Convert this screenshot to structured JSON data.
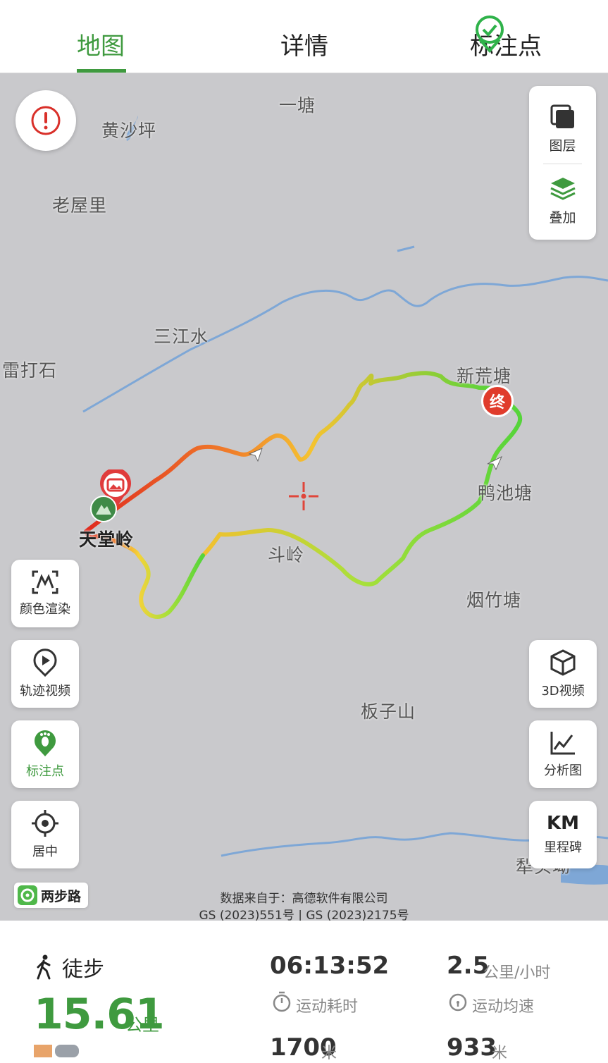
{
  "tabs": [
    {
      "label": "地图",
      "active": true
    },
    {
      "label": "详情",
      "active": false
    },
    {
      "label": "标注点",
      "active": false
    }
  ],
  "map": {
    "places": [
      {
        "name": "一塘",
        "bold": false
      },
      {
        "name": "黄沙坪",
        "bold": false
      },
      {
        "name": "老屋里",
        "bold": false
      },
      {
        "name": "三江水",
        "bold": false
      },
      {
        "name": "雷打石",
        "bold": false
      },
      {
        "name": "新荒塘",
        "bold": false
      },
      {
        "name": "鸭池塘",
        "bold": false
      },
      {
        "name": "天堂岭",
        "bold": true
      },
      {
        "name": "斗岭",
        "bold": false
      },
      {
        "name": "烟竹塘",
        "bold": false
      },
      {
        "name": "板子山",
        "bold": false
      },
      {
        "name": "犁头坳",
        "bold": false
      }
    ],
    "end_marker": "终",
    "layer_label": "图层",
    "overlay_label": "叠加",
    "left_buttons": [
      "颜色渲染",
      "轨迹视频",
      "标注点",
      "居中"
    ],
    "right_buttons": [
      "3D视频",
      "分析图",
      "里程碑"
    ],
    "km_text": "KM",
    "brand_label": "两步路",
    "copyright_line1": "数据来自于：高德软件有限公司",
    "copyright_line2": "GS (2023)551号 | GS (2023)2175号",
    "colors": {
      "water": "#7ea7d6",
      "track_start": "#e02a1e",
      "track_mid": "#f5c330",
      "track_end": "#55d43a",
      "accent": "#3f9a3f"
    }
  },
  "stats": {
    "mode": "徒步",
    "distance": "15.61",
    "distance_unit": "公里",
    "duration": "06:13:52",
    "duration_label": "运动耗时",
    "speed": "2.5",
    "speed_unit": "公里/小时",
    "speed_label": "运动均速",
    "ascent": "1700",
    "ascent_unit": "米",
    "max_alt": "933",
    "max_alt_unit": "米"
  }
}
